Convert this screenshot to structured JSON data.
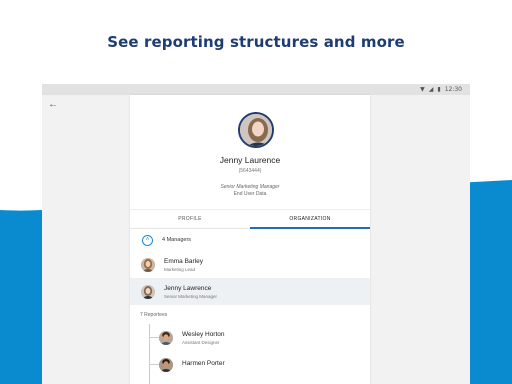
{
  "headline": "See reporting structures and more",
  "colors": {
    "brand_blue": "#0a8bd0",
    "headline": "#1f3d73",
    "tab_accent": "#1f6fb0"
  },
  "statusbar": {
    "time": "12:30",
    "wifi_icon": "wifi-icon",
    "signal_icon": "signal-icon",
    "battery_icon": "battery-icon"
  },
  "nav": {
    "back_icon": "arrow-left-icon"
  },
  "profile": {
    "name": "Jenny Laurence",
    "employee_id": "(5643444)",
    "title": "Senior Marketing Manager",
    "subtitle": "End User Data"
  },
  "tabs": [
    {
      "label": "PROFILE",
      "active": false
    },
    {
      "label": "ORGANIZATION",
      "active": true
    }
  ],
  "managers": {
    "label": "4 Managers",
    "people": [
      {
        "name": "Emma Barley",
        "role": "Marketing Lead"
      },
      {
        "name": "Jenny Lawrence",
        "role": "Senior Marketing Manager"
      }
    ]
  },
  "reportees": {
    "label": "7 Reportees",
    "people": [
      {
        "name": "Wesley Horton",
        "role": "Assistant Designer"
      },
      {
        "name": "Harmen Porter",
        "role": ""
      }
    ]
  }
}
